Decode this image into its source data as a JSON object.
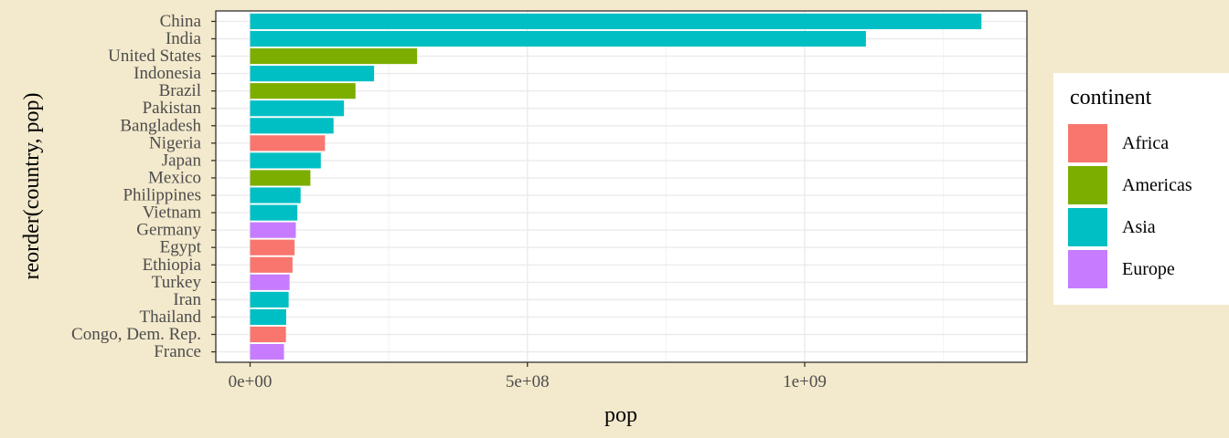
{
  "chart_data": {
    "type": "bar",
    "orientation": "horizontal",
    "xlabel": "pop",
    "ylabel": "reorder(country, pop)",
    "xlim": [
      -40000000,
      1390000000
    ],
    "x_ticks": [
      0,
      500000000,
      1000000000
    ],
    "x_tick_labels": [
      "0e+00",
      "5e+08",
      "1e+09"
    ],
    "grid": true,
    "legend_position": "right",
    "legend": {
      "title": "continent",
      "entries": [
        {
          "label": "Africa",
          "color": "#F8766D"
        },
        {
          "label": "Americas",
          "color": "#7CAE00"
        },
        {
          "label": "Asia",
          "color": "#00BFC4"
        },
        {
          "label": "Europe",
          "color": "#C77CFF"
        }
      ]
    },
    "bars": [
      {
        "country": "China",
        "continent": "Asia",
        "pop": 1318683096
      },
      {
        "country": "India",
        "continent": "Asia",
        "pop": 1110396331
      },
      {
        "country": "United States",
        "continent": "Americas",
        "pop": 301139947
      },
      {
        "country": "Indonesia",
        "continent": "Asia",
        "pop": 223547000
      },
      {
        "country": "Brazil",
        "continent": "Americas",
        "pop": 190010647
      },
      {
        "country": "Pakistan",
        "continent": "Asia",
        "pop": 169270617
      },
      {
        "country": "Bangladesh",
        "continent": "Asia",
        "pop": 150448339
      },
      {
        "country": "Nigeria",
        "continent": "Africa",
        "pop": 135031164
      },
      {
        "country": "Japan",
        "continent": "Asia",
        "pop": 127467972
      },
      {
        "country": "Mexico",
        "continent": "Americas",
        "pop": 108700891
      },
      {
        "country": "Philippines",
        "continent": "Asia",
        "pop": 91077287
      },
      {
        "country": "Vietnam",
        "continent": "Asia",
        "pop": 85262356
      },
      {
        "country": "Germany",
        "continent": "Europe",
        "pop": 82400996
      },
      {
        "country": "Egypt",
        "continent": "Africa",
        "pop": 80264543
      },
      {
        "country": "Ethiopia",
        "continent": "Africa",
        "pop": 76511887
      },
      {
        "country": "Turkey",
        "continent": "Europe",
        "pop": 71158647
      },
      {
        "country": "Iran",
        "continent": "Asia",
        "pop": 69453570
      },
      {
        "country": "Thailand",
        "continent": "Asia",
        "pop": 65068149
      },
      {
        "country": "Congo, Dem. Rep.",
        "continent": "Africa",
        "pop": 64606759
      },
      {
        "country": "France",
        "continent": "Europe",
        "pop": 61083916
      }
    ]
  }
}
